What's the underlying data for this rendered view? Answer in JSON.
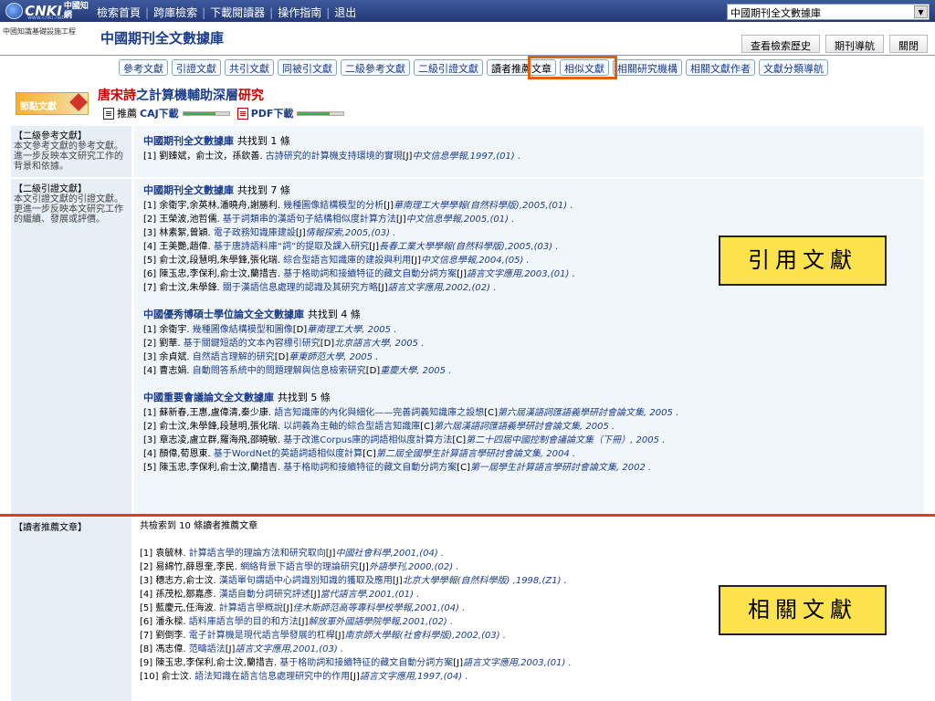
{
  "topbar": {
    "logo_text": "CNKI",
    "logo_cn": "中國知網",
    "logo_url": "www.cnki.net",
    "nav": [
      "檢索首頁",
      "跨庫檢索",
      "下載閱讀器",
      "操作指南",
      "退出"
    ],
    "db_select_value": "中國期刊全文數據庫"
  },
  "header": {
    "subtitle": "中國知識基礎設施工程",
    "db_title": "中國期刊全文數據庫",
    "links": [
      "查看檢索歷史",
      "期刊導航",
      "關閉"
    ]
  },
  "tabs": [
    "參考文獻",
    "引證文獻",
    "共引文獻",
    "同被引文獻",
    "二級參考文獻",
    "二級引證文獻",
    "讀者推薦文章",
    "相似文獻",
    "相關研究機構",
    "相關文獻作者",
    "文獻分類導航"
  ],
  "active_tab": "讀者推薦文章",
  "article": {
    "banner": "節點文獻",
    "title_red1": "唐宋詩",
    "title_blue": "之計算機輔助深層",
    "title_red2": "研究",
    "recommend": "推薦",
    "caj_download": "CAJ下載",
    "pdf_download": "PDF下載"
  },
  "sec2ref": {
    "side_head": "【二級參考文獻】",
    "side_text": "本文參考文獻的參考文獻。進一步反映本文研究工作的背景和依據。",
    "groups": [
      {
        "db": "中國期刊全文數據庫",
        "count": "共找到 1 條",
        "refs": [
          {
            "n": "[1]",
            "au": "劉臻斌，俞士汶，孫欽善.",
            "ti": "古詩研究的計算機支持環境的實現",
            "ty": "[J]",
            "jo": "中文信息學報",
            "yr": ",1997,(01) ."
          }
        ]
      }
    ]
  },
  "sec2cite": {
    "side_head": "【二級引證文獻】",
    "side_text": "本文引證文獻的引證文獻。更進一步反映本文研究工作的繼續、發展或評價。",
    "groups": [
      {
        "db": "中國期刊全文數據庫",
        "count": "共找到 7 條",
        "refs": [
          {
            "n": "[1]",
            "au": "余衛宇,余英林,潘曉舟,謝勝利.",
            "ti": "幾種圖像結構模型的分析",
            "ty": "[J]",
            "jo": "華南理工大學學報(自然科學版)",
            "yr": ",2005,(01) ."
          },
          {
            "n": "[2]",
            "au": "王榮波,池哲儒.",
            "ti": "基于詞類串的漢語句子結構相似度計算方法",
            "ty": "[J]",
            "jo": "中文信息學報",
            "yr": ",2005,(01) ."
          },
          {
            "n": "[3]",
            "au": "林素絮,曾穎.",
            "ti": "電子政務知識庫建設",
            "ty": "[J]",
            "jo": "情報探索",
            "yr": ",2005,(03) ."
          },
          {
            "n": "[4]",
            "au": "王美艷,趙偉.",
            "ti": "基于唐詩語料庫“詞”的提取及課入研究",
            "ty": "[J]",
            "jo": "長春工業大學學報(自然科學版)",
            "yr": ",2005,(03) ."
          },
          {
            "n": "[5]",
            "au": "俞士汶,段慧明,朱學鋒,張化瑞.",
            "ti": "綜合型語言知識庫的建設與利用",
            "ty": "[J]",
            "jo": "中文信息學報",
            "yr": ",2004,(05) ."
          },
          {
            "n": "[6]",
            "au": "陳玉忠,李保利,俞士汶,蘭措吉.",
            "ti": "基于格助詞和接續特征的藏文自動分詞方案",
            "ty": "[J]",
            "jo": "語言文字應用",
            "yr": ",2003,(01) ."
          },
          {
            "n": "[7]",
            "au": "俞士汶,朱學鋒.",
            "ti": "關于漢語信息處理的認識及其研究方略",
            "ty": "[J]",
            "jo": "語言文字應用",
            "yr": ",2002,(02) ."
          }
        ]
      },
      {
        "db": "中國優秀博碩士學位論文全文數據庫",
        "count": "共找到 4 條",
        "refs": [
          {
            "n": "[1]",
            "au": "余衛宇.",
            "ti": "幾種圖像結構模型和圖像",
            "ty": "[D]",
            "jo": "華南理工大學",
            "yr": ", 2005 ."
          },
          {
            "n": "[2]",
            "au": "劉華.",
            "ti": "基于關鍵短語的文本內容標引研究",
            "ty": "[D]",
            "jo": "北京語言大學",
            "yr": ", 2005 ."
          },
          {
            "n": "[3]",
            "au": "余貞斌.",
            "ti": "自然語言理解的研究",
            "ty": "[D]",
            "jo": "華東師范大學",
            "yr": ", 2005 ."
          },
          {
            "n": "[4]",
            "au": "曹志娟.",
            "ti": "自動問答系統中的問題理解與信息檢索研究",
            "ty": "[D]",
            "jo": "重慶大學",
            "yr": ", 2005 ."
          }
        ]
      },
      {
        "db": "中國重要會議論文全文數據庫",
        "count": "共找到 5 條",
        "refs": [
          {
            "n": "[1]",
            "au": "蘇新春,王惠,盧偉清,秦少康.",
            "ti": "語言知識庫的內化與細化——完善詞義知識庫之設想",
            "ty": "[C]",
            "jo": "第六屆漢語詞匯語義學研討會論文集",
            "yr": ", 2005 ."
          },
          {
            "n": "[2]",
            "au": "俞士汶,朱學鋒,段慧明,張化瑞.",
            "ti": "以詞義為主軸的綜合型語言知識庫",
            "ty": "[C]",
            "jo": "第六屆漢語詞匯語義學研討會論文集",
            "yr": ", 2005 ."
          },
          {
            "n": "[3]",
            "au": "章志凌,盧立群,羅海飛,邵曉敏.",
            "ti": "基于改進Corpus庫的詞語相似度計算方法",
            "ty": "[C]",
            "jo": "第二十四屆中國控制會議論文集（下冊）",
            "yr": ", 2005 ."
          },
          {
            "n": "[4]",
            "au": "顏偉,荀恩東.",
            "ti": "基于WordNet的英語詞語相似度計算",
            "ty": "[C]",
            "jo": "第二屆全國學生計算語言學研討會論文集",
            "yr": ", 2004 ."
          },
          {
            "n": "[5]",
            "au": "陳玉忠,李保利,俞士汶,蘭措吉.",
            "ti": "基于格助詞和接續特征的藏文自動分詞方案",
            "ty": "[C]",
            "jo": "第一屆學生計算語言學研討會論文集",
            "yr": ", 2002 ."
          }
        ]
      }
    ]
  },
  "recommend": {
    "side_head": "【讀者推薦文章】",
    "count": "共檢索到 10 條讀者推薦文章",
    "refs": [
      {
        "n": "[1]",
        "au": "袁毓林.",
        "ti": "計算語言學的理論方法和研究取向",
        "ty": "[J]",
        "jo": "中國社會科學",
        "yr": ",2001,(04) ."
      },
      {
        "n": "[2]",
        "au": "易綿竹,薛恩奎,李民.",
        "ti": "網絡背景下語言學的理論研究",
        "ty": "[J]",
        "jo": "外語學刊",
        "yr": ",2000,(02) ."
      },
      {
        "n": "[3]",
        "au": "穗志方,俞士汶.",
        "ti": "漢語單句謂語中心詞識別知識的獲取及應用",
        "ty": "[J]",
        "jo": "北京大學學報(自然科學版)",
        "yr": " ,1998,(Z1) ."
      },
      {
        "n": "[4]",
        "au": "孫茂松,鄒嘉彥.",
        "ti": "漢語自動分詞研究評述",
        "ty": "[J]",
        "jo": "當代語言學",
        "yr": ",2001,(01) ."
      },
      {
        "n": "[5]",
        "au": "藍慶元,任海波.",
        "ti": "計算語言學概說",
        "ty": "[J]",
        "jo": "佳木斯師范高等專科學校學報",
        "yr": ",2001,(04) ."
      },
      {
        "n": "[6]",
        "au": "潘永樑.",
        "ti": "語料庫語言學的目的和方法",
        "ty": "[J]",
        "jo": "解放軍外國語學院學報",
        "yr": ",2001,(02) ."
      },
      {
        "n": "[7]",
        "au": "劉倒李.",
        "ti": "電子計算機是現代語言學發展的杠桿",
        "ty": "[J]",
        "jo": "南京師大學報(社會科學版)",
        "yr": ",2002,(03) ."
      },
      {
        "n": "[8]",
        "au": "馮志偉.",
        "ti": "范疇語法",
        "ty": "[J]",
        "jo": "語言文字應用",
        "yr": ",2001,(03) ."
      },
      {
        "n": "[9]",
        "au": "陳玉忠,李保利,俞士汶,蘭措吉.",
        "ti": "基于格助詞和接續特征的藏文自動分詞方案",
        "ty": "[J]",
        "jo": "語言文字應用",
        "yr": ",2003,(01) ."
      },
      {
        "n": "[10]",
        "au": "俞士汶.",
        "ti": "語法知識在語言信息處理研究中的作用",
        "ty": "[J]",
        "jo": "語言文字應用",
        "yr": ",1997,(04) ."
      }
    ]
  },
  "annotations": {
    "cited": "引用文獻",
    "related": "相關文獻"
  },
  "colors": {
    "link_blue": "#1a3c8c",
    "highlight_orange": "#e06010",
    "annotation_yellow": "#fde34e"
  }
}
